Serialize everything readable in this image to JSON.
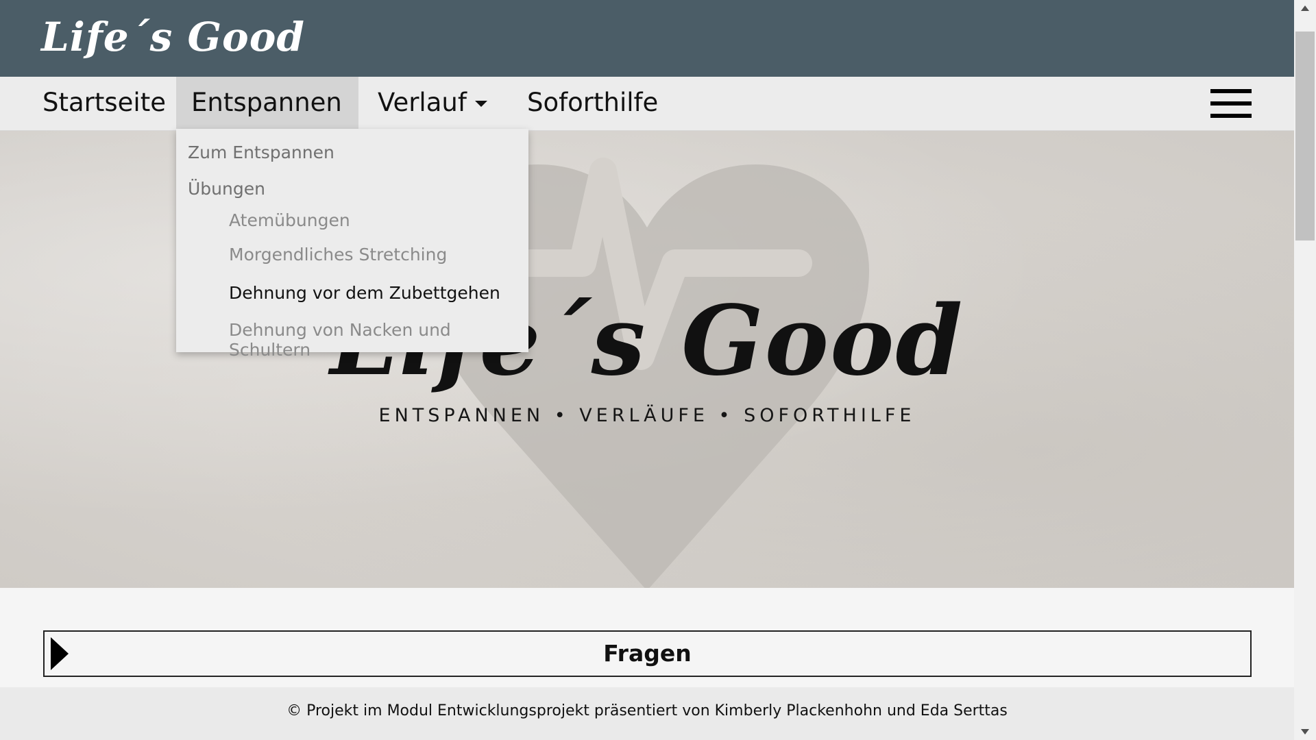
{
  "header": {
    "brand": "Life´s Good"
  },
  "nav": {
    "items": [
      {
        "label": "Startseite"
      },
      {
        "label": "Entspannen"
      },
      {
        "label": "Verlauf"
      },
      {
        "label": "Soforthilfe"
      }
    ],
    "menu_icon": "hamburger-icon"
  },
  "dropdown": {
    "header_link": "Zum Entspannen",
    "section": "Übungen",
    "items": [
      {
        "label": "Atemübungen"
      },
      {
        "label": "Morgendliches Stretching"
      },
      {
        "label": "Dehnung vor dem Zubettgehen"
      },
      {
        "label": "Dehnung von Nacken und Schultern"
      }
    ]
  },
  "hero": {
    "logo_text": "Life´s Good",
    "tagline": "ENTSPANNEN • VERLÄUFE • SOFORTHILFE"
  },
  "accordion": {
    "title": "Fragen"
  },
  "footer": {
    "text": "© Projekt im Modul Entwicklungsprojekt präsentiert von Kimberly Plackenhohn und Eda Serttas"
  },
  "colors": {
    "header_bg": "#4b5d67",
    "nav_bg": "#ececec",
    "nav_active_bg": "#d4d4d4",
    "dropdown_bg": "#ececec",
    "dropdown_hover_text": "#111111"
  }
}
